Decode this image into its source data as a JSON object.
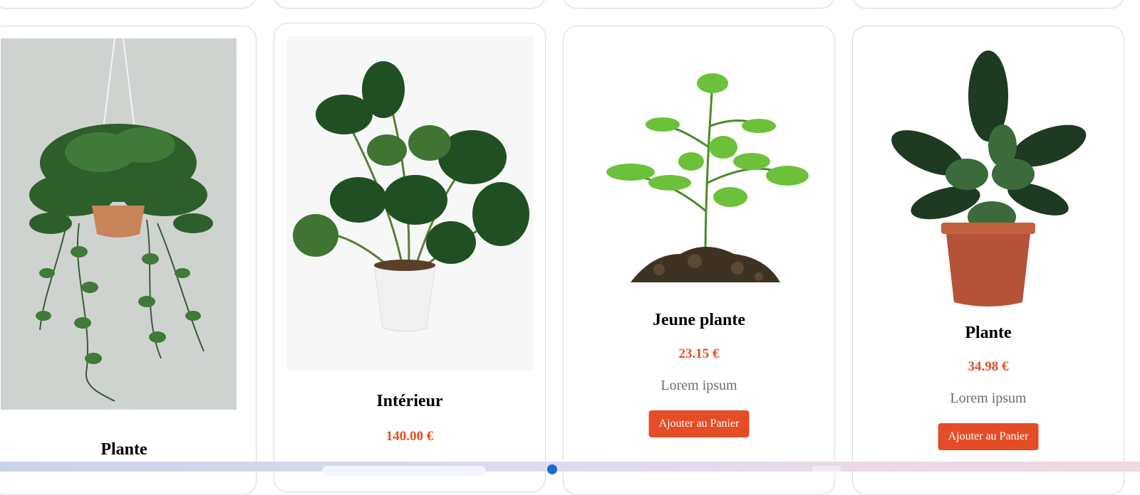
{
  "colors": {
    "accent": "#e44d26",
    "price": "#e44d26",
    "description": "#6e6e6e",
    "card_border": "#dcdce4"
  },
  "products": [
    {
      "title": "Plante",
      "image": "hanging-pothos-plant-image"
    },
    {
      "title": "Intérieur",
      "price": "140.00 €",
      "image": "monstera-potted-plant-image"
    },
    {
      "title": "Jeune plante",
      "price": "23.15 €",
      "description": "Lorem ipsum",
      "button_label": "Ajouter au Panier",
      "image": "seedling-in-soil-image"
    },
    {
      "title": "Plante",
      "price": "34.98 €",
      "description": "Lorem ipsum",
      "button_label": "Ajouter au Panier",
      "image": "philodendron-in-terracotta-pot-image"
    }
  ]
}
